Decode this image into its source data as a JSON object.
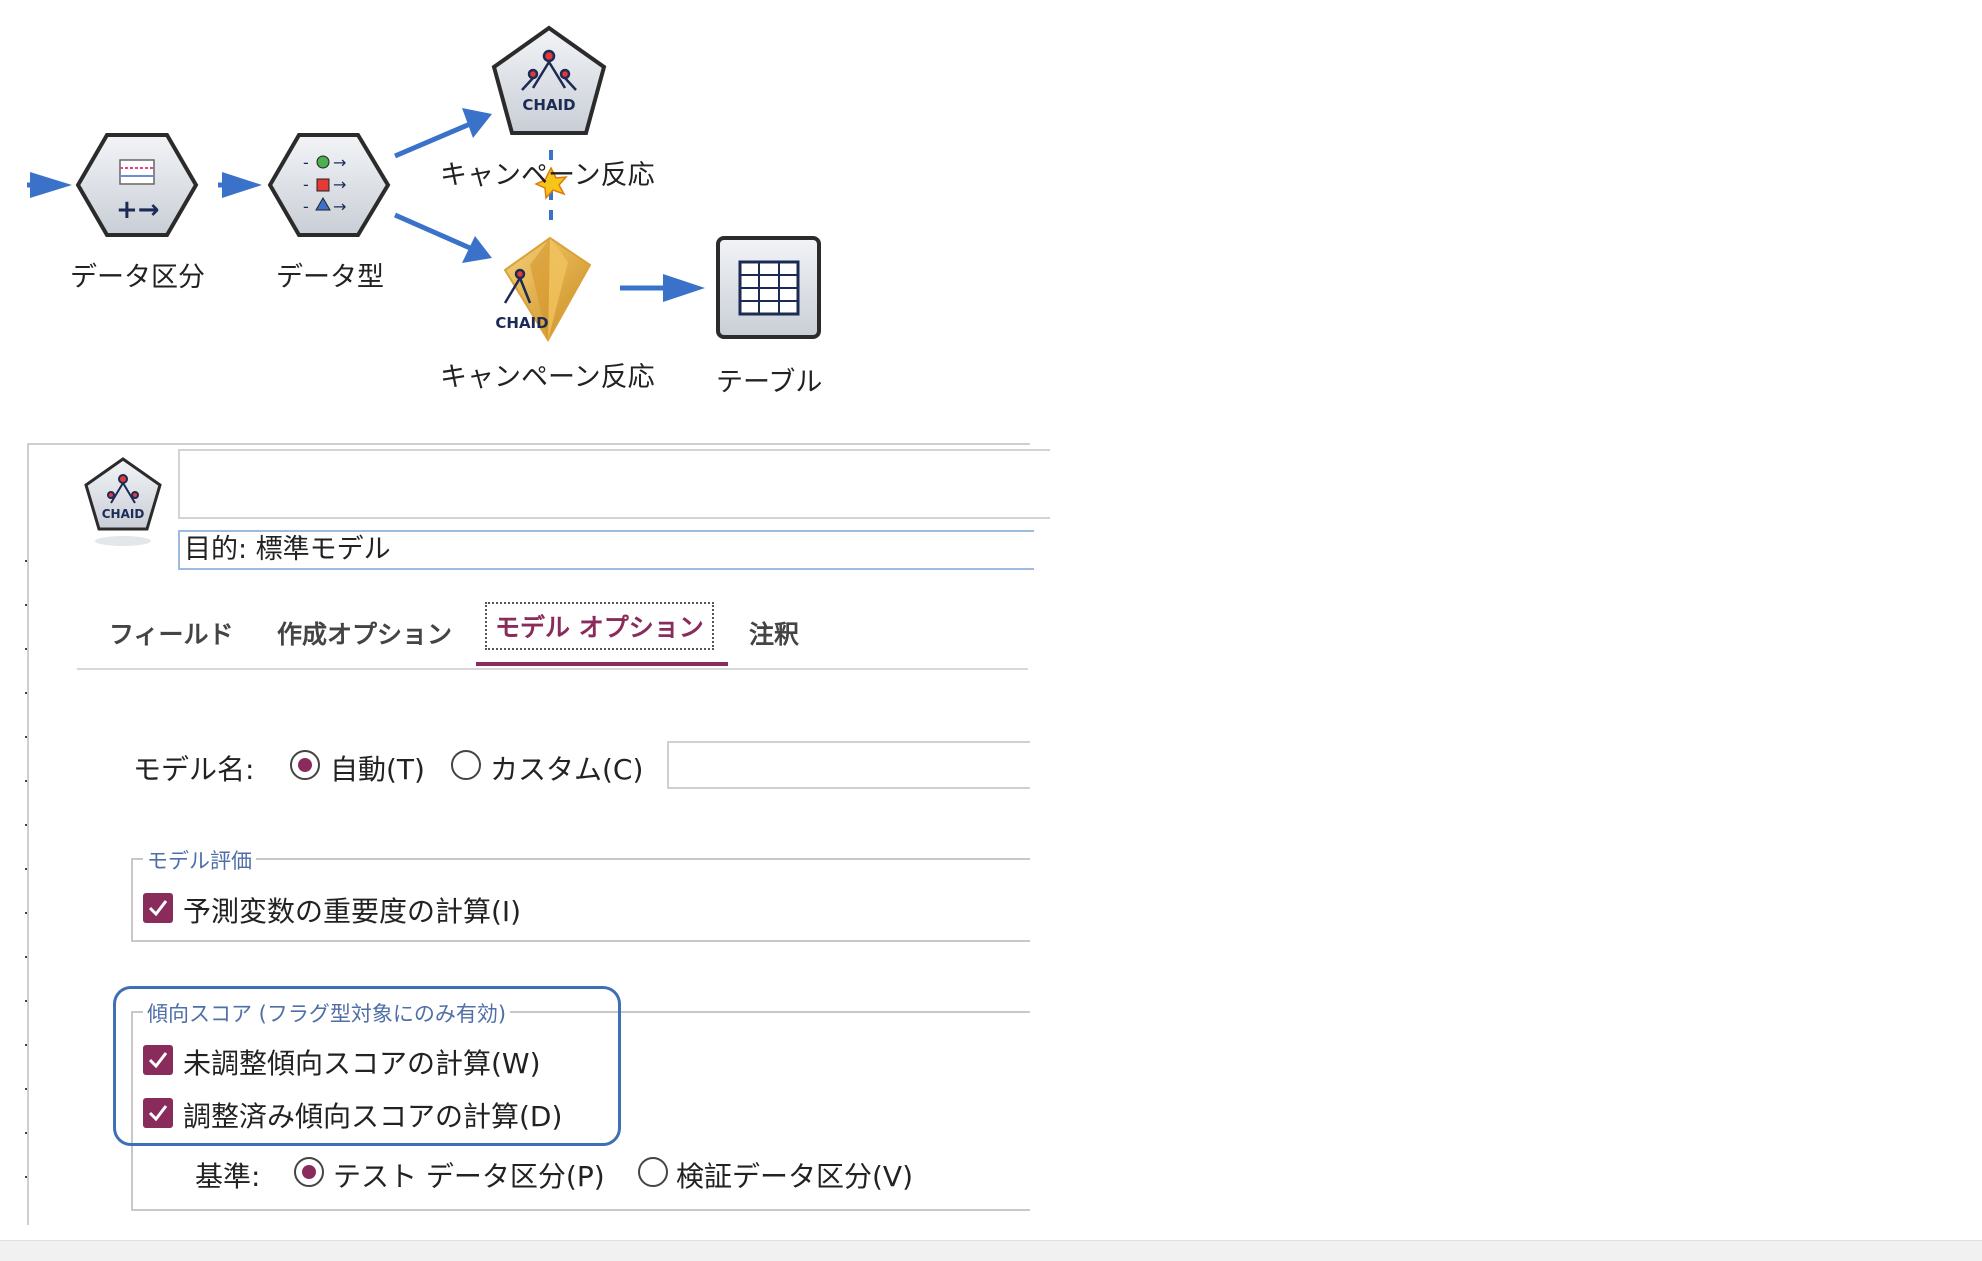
{
  "canvas": {
    "nodes": {
      "partition": {
        "label": "データ区分"
      },
      "type": {
        "label": "データ型"
      },
      "chaid_model": {
        "label": "キャンペーン反応",
        "icon_text": "CHAID"
      },
      "chaid_nugget": {
        "label": "キャンペーン反応",
        "icon_text": "CHAID"
      },
      "table": {
        "label": "テーブル"
      }
    }
  },
  "dialog": {
    "node_icon_text": "CHAID",
    "name_value": "",
    "objective": "目的: 標準モデル",
    "tabs": [
      {
        "label": "フィールド"
      },
      {
        "label": "作成オプション"
      },
      {
        "label": "モデル オプション",
        "active": true
      },
      {
        "label": "注釈"
      }
    ],
    "model_name": {
      "label": "モデル名:",
      "auto_label": "自動(T)",
      "custom_label": "カスタム(C)",
      "selected": "auto",
      "custom_value": ""
    },
    "model_evaluation": {
      "title": "モデル評価",
      "predictor_importance": {
        "label": "予測変数の重要度の計算(I)",
        "checked": true
      }
    },
    "propensity": {
      "title": "傾向スコア (フラグ型対象にのみ有効)",
      "raw": {
        "label": "未調整傾向スコアの計算(W)",
        "checked": true
      },
      "adjusted": {
        "label": "調整済み傾向スコアの計算(D)",
        "checked": true
      },
      "base": {
        "label": "基準:",
        "test_label": "テスト データ区分(P)",
        "validation_label": "検証データ区分(V)",
        "selected": "test"
      }
    }
  },
  "colors": {
    "accent": "#8a2c5b",
    "arrow": "#3b72c9",
    "highlight": "#3f6fb5",
    "group_title": "#4f6fa6",
    "nugget_gold": "#e6b24a"
  }
}
